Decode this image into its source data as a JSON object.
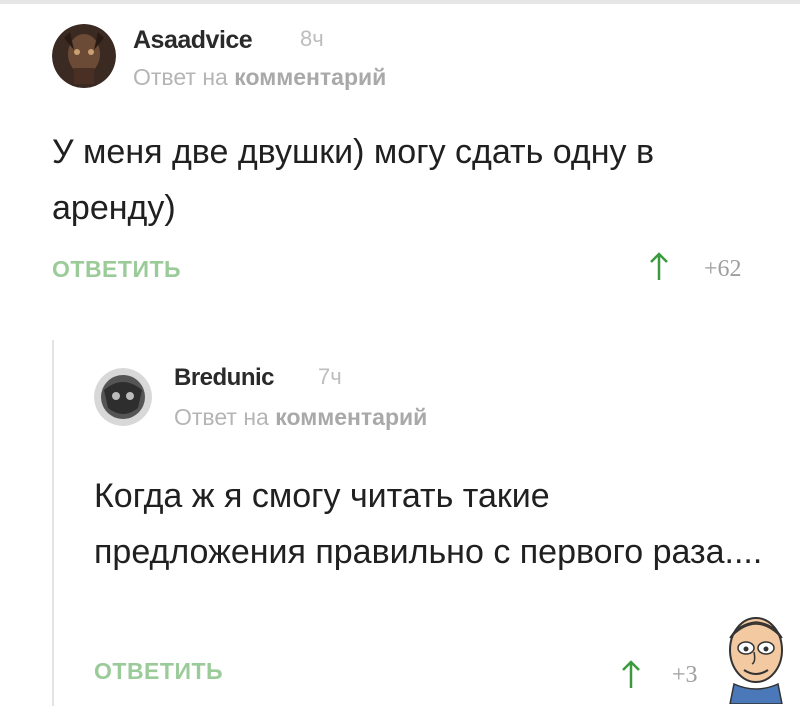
{
  "comments": [
    {
      "username": "Asaadvice",
      "time": "8ч",
      "reply_prefix": "Ответ на",
      "reply_target": "комментарий",
      "text": "У меня две двушки) могу сдать одну в аренду)",
      "reply_label": "ОТВЕТИТЬ",
      "score": "+62"
    },
    {
      "username": "Bredunic",
      "time": "7ч",
      "reply_prefix": "Ответ на",
      "reply_target": "комментарий",
      "text": "Когда ж я смогу читать такие предложения правильно с первого раза....",
      "reply_label": "ОТВЕТИТЬ",
      "score": "+3"
    }
  ],
  "colors": {
    "accent_green": "#9ccb9a",
    "meta_gray": "#b5b5b5",
    "text": "#202020"
  },
  "icons": {
    "vote": "arrow-up-icon",
    "watermark": "cartoon-face-logo"
  }
}
